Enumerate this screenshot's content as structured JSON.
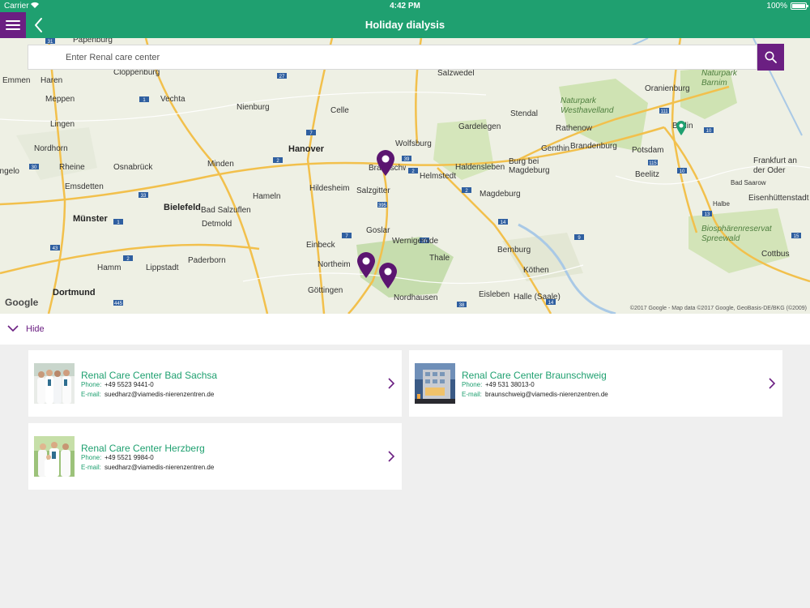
{
  "status_bar": {
    "carrier": "Carrier",
    "time": "4:42 PM",
    "battery": "100%"
  },
  "header": {
    "title": "Holiday dialysis"
  },
  "search": {
    "placeholder": "Enter Renal care center"
  },
  "map": {
    "cities": [
      {
        "name": "Papenburg",
        "big": false
      },
      {
        "name": "Cloppenburg",
        "big": false
      },
      {
        "name": "Emmen",
        "big": false
      },
      {
        "name": "Haren",
        "big": false
      },
      {
        "name": "Meppen",
        "big": false
      },
      {
        "name": "Vechta",
        "big": false
      },
      {
        "name": "Lingen",
        "big": false
      },
      {
        "name": "Nordhorn",
        "big": false
      },
      {
        "name": "Rheine",
        "big": false
      },
      {
        "name": "Osnabrück",
        "big": false
      },
      {
        "name": "Emsdetten",
        "big": false
      },
      {
        "name": "Münster",
        "big": true
      },
      {
        "name": "Hamm",
        "big": false
      },
      {
        "name": "Dortmund",
        "big": true
      },
      {
        "name": "Bielefeld",
        "big": true
      },
      {
        "name": "Detmold",
        "big": false
      },
      {
        "name": "Lippstadt",
        "big": false
      },
      {
        "name": "Paderborn",
        "big": false
      },
      {
        "name": "Minden",
        "big": false
      },
      {
        "name": "Bad Salzuflen",
        "big": false
      },
      {
        "name": "Hameln",
        "big": false
      },
      {
        "name": "Nienburg",
        "big": false
      },
      {
        "name": "Celle",
        "big": false
      },
      {
        "name": "Hanover",
        "big": true
      },
      {
        "name": "Hildesheim",
        "big": false
      },
      {
        "name": "Salzgitter",
        "big": false
      },
      {
        "name": "Braunschweig",
        "big": false
      },
      {
        "name": "Wolfsburg",
        "big": false
      },
      {
        "name": "Helmstedt",
        "big": false
      },
      {
        "name": "Goslar",
        "big": false
      },
      {
        "name": "Wernigerode",
        "big": false
      },
      {
        "name": "Einbeck",
        "big": false
      },
      {
        "name": "Northeim",
        "big": false
      },
      {
        "name": "Göttingen",
        "big": false
      },
      {
        "name": "Nordhausen",
        "big": false
      },
      {
        "name": "Thale",
        "big": false
      },
      {
        "name": "Bernburg",
        "big": false
      },
      {
        "name": "Köthen",
        "big": false
      },
      {
        "name": "Eisleben",
        "big": false
      },
      {
        "name": "Halle (Saale)",
        "big": false
      },
      {
        "name": "Magdeburg",
        "big": false
      },
      {
        "name": "Haldensleben",
        "big": false
      },
      {
        "name": "Burg bei Magdeburg",
        "big": false
      },
      {
        "name": "Gardelegen",
        "big": false
      },
      {
        "name": "Salzwedel",
        "big": false
      },
      {
        "name": "Stendal",
        "big": false
      },
      {
        "name": "Rathenow",
        "big": false
      },
      {
        "name": "Genthin",
        "big": false
      },
      {
        "name": "Brandenburg",
        "big": false
      },
      {
        "name": "Potsdam",
        "big": false
      },
      {
        "name": "Berlin",
        "big": false
      },
      {
        "name": "Oranienburg",
        "big": false
      },
      {
        "name": "Beelitz",
        "big": false
      },
      {
        "name": "Frankfurt an der Oder",
        "big": false
      },
      {
        "name": "Bad Saarow",
        "big": false
      },
      {
        "name": "Halbe",
        "big": false
      },
      {
        "name": "Eisenhüttenstadt",
        "big": false
      },
      {
        "name": "Cottbus",
        "big": false
      },
      {
        "name": "Lingelo",
        "big": false
      }
    ],
    "regions": [
      "Naturpark Westhavelland",
      "Naturpark Barnim",
      "Biosphärenreservat Spreewald"
    ],
    "google_logo": "Google",
    "attribution": "©2017 Google - Map data ©2017 Google, GeoBasis-DE/BKG (©2009)"
  },
  "toggle": {
    "label": "Hide"
  },
  "centers": [
    {
      "name": "Renal Care Center Bad Sachsa",
      "phone_label": "Phone:",
      "phone": "+49 5523 9441-0",
      "email_label": "E-mail:",
      "email": "suedharz@viamedis-nierenzentren.de"
    },
    {
      "name": "Renal Care Center Braunschweig",
      "phone_label": "Phone:",
      "phone": "+49 531 38013-0",
      "email_label": "E-mail:",
      "email": "braunschweig@viamedis-nierenzentren.de"
    },
    {
      "name": "Renal Care Center Herzberg",
      "phone_label": "Phone:",
      "phone": "+49 5521 9984-0",
      "email_label": "E-mail:",
      "email": "suedharz@viamedis-nierenzentren.de"
    }
  ],
  "colors": {
    "brand_green": "#1fa070",
    "brand_purple": "#6b1f82"
  }
}
